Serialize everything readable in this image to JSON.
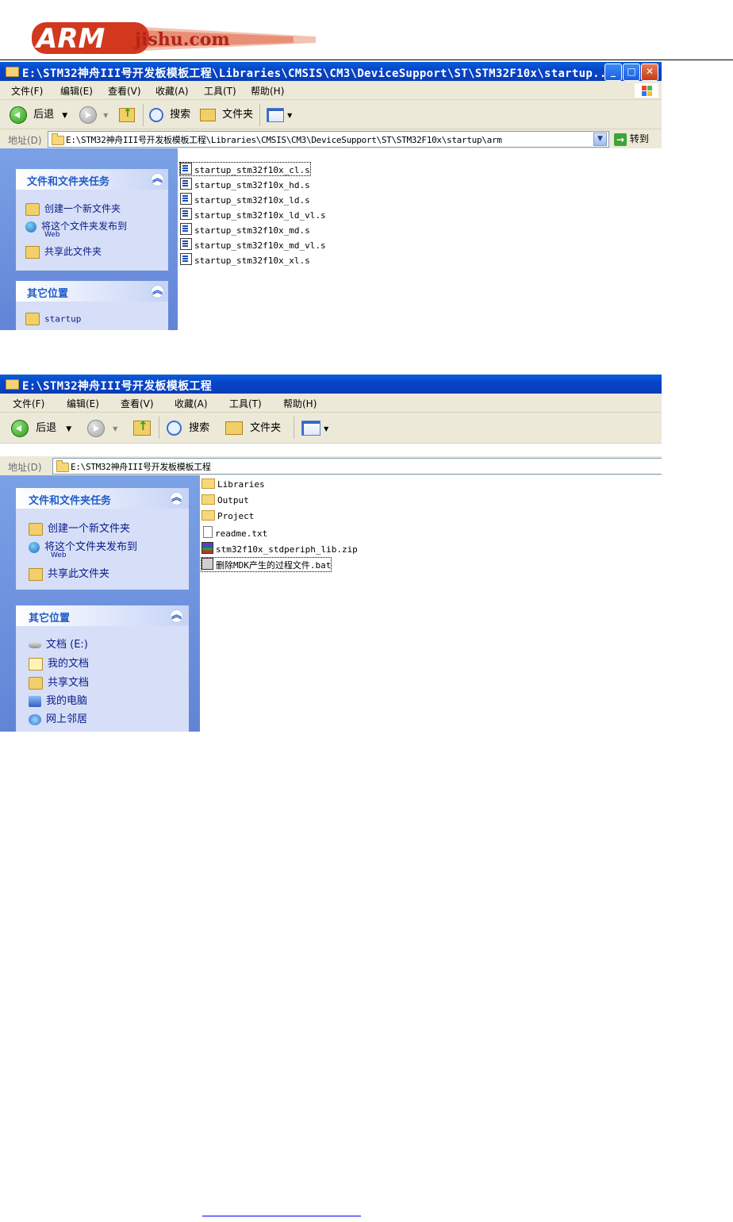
{
  "logo": {
    "text_left": "ARM",
    "text_right": "jishu.com"
  },
  "window1": {
    "title": "E:\\STM32神舟III号开发板模板工程\\Libraries\\CMSIS\\CM3\\DeviceSupport\\ST\\STM32F10x\\startup...",
    "menu": [
      "文件(F)",
      "编辑(E)",
      "查看(V)",
      "收藏(A)",
      "工具(T)",
      "帮助(H)"
    ],
    "toolbar": {
      "back": "后退",
      "search": "搜索",
      "folders": "文件夹"
    },
    "address_label": "地址(D)",
    "address": "E:\\STM32神舟III号开发板模板工程\\Libraries\\CMSIS\\CM3\\DeviceSupport\\ST\\STM32F10x\\startup\\arm",
    "go_label": "转到",
    "tasks": {
      "title": "文件和文件夹任务",
      "items": [
        "创建一个新文件夹",
        "将这个文件夹发布到",
        "共享此文件夹"
      ],
      "web": "Web"
    },
    "places": {
      "title": "其它位置",
      "items": [
        "startup"
      ]
    },
    "files": [
      "startup_stm32f10x_cl.s",
      "startup_stm32f10x_hd.s",
      "startup_stm32f10x_ld.s",
      "startup_stm32f10x_ld_vl.s",
      "startup_stm32f10x_md.s",
      "startup_stm32f10x_md_vl.s",
      "startup_stm32f10x_xl.s"
    ]
  },
  "window2": {
    "title": "E:\\STM32神舟III号开发板模板工程",
    "menu": [
      "文件(F)",
      "编辑(E)",
      "查看(V)",
      "收藏(A)",
      "工具(T)",
      "帮助(H)"
    ],
    "toolbar": {
      "back": "后退",
      "search": "搜索",
      "folders": "文件夹"
    },
    "address_label": "地址(D)",
    "address": "E:\\STM32神舟III号开发板模板工程",
    "tasks": {
      "title": "文件和文件夹任务",
      "items": [
        "创建一个新文件夹",
        "将这个文件夹发布到",
        "共享此文件夹"
      ],
      "web": "Web"
    },
    "places": {
      "title": "其它位置",
      "items": [
        "文档 (E:)",
        "我的文档",
        "共享文档",
        "我的电脑",
        "网上邻居"
      ]
    },
    "files": [
      {
        "name": "Libraries",
        "icon": "folder-icon"
      },
      {
        "name": "Output",
        "icon": "folder-icon"
      },
      {
        "name": "Project",
        "icon": "folder-icon"
      },
      {
        "name": "readme.txt",
        "icon": "text-file-icon"
      },
      {
        "name": "stm32f10x_stdperiph_lib.zip",
        "icon": "zip-archive-icon"
      },
      {
        "name": "删除MDK产生的过程文件.bat",
        "icon": "batch-file-icon"
      }
    ]
  },
  "colors": {
    "title_bar": "#0a5ed8",
    "task_pane": "#7aa1e6",
    "link": "#0000ff"
  }
}
